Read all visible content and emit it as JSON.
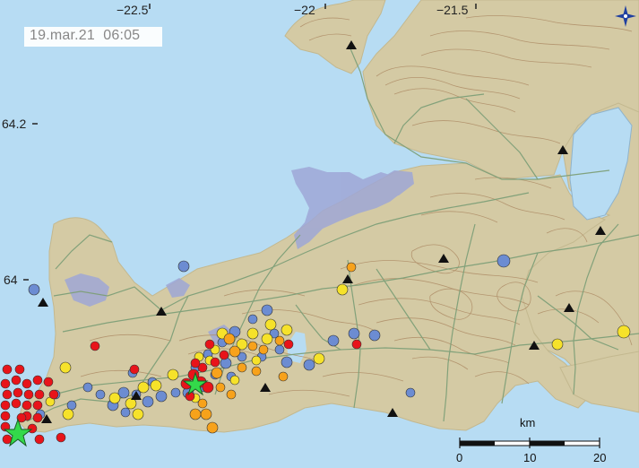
{
  "timestamp": "19.mar.21  06:05",
  "lon_labels": [
    "−22.5",
    "−22",
    "−21.5"
  ],
  "lat_labels": [
    "64.2",
    "64"
  ],
  "scale": {
    "unit": "km",
    "ticks": [
      "0",
      "10",
      "20"
    ]
  },
  "colors": {
    "sea": "#b7dcf3",
    "land": "#d4caa4",
    "contours": "#b0906a",
    "roads": "#7e9f78",
    "lava": "#9fa7d6",
    "quake_red": "#e8141a",
    "quake_orange": "#f7a21b",
    "quake_yellow": "#f6e22a",
    "quake_blue": "#6c8cd2",
    "star": "#33d94a"
  },
  "icons": [
    "station-triangle-icon",
    "large-quake-star-icon",
    "north-arrow-icon"
  ]
}
